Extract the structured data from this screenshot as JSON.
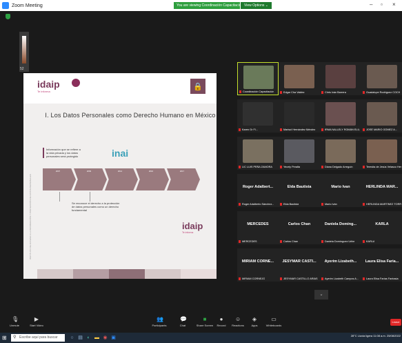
{
  "window": {
    "title": "Zoom Meeting",
    "share_banner": "You are viewing Coordinación Capacitación's screen",
    "view_options": "View Options ⌄",
    "minimize": "–",
    "restore": "▫",
    "close": "×"
  },
  "self_view": {
    "label": "52"
  },
  "slide": {
    "logo_text": "idaip",
    "logo_tag": "Te informa",
    "logo_tag2": "Te informa",
    "lock_icon": "lock-icon",
    "title": "I. Los Datos Personales como Derecho Humano en México",
    "side_text": "INSTITUTO DE ACCESO A LA INFORMACIÓN Y PROTECCIÓN DE DATOS PERSONALES",
    "box_text": "Información que se refiere a la vida privada y los datos personales será protegido",
    "inai_text": "inai",
    "bottom_text": "Se reconoce el derecho a la protección de datos personales como un derecho fundamental",
    "arrows": [
      "2007",
      "2009",
      "2014",
      "2016",
      "2017"
    ],
    "footer_colors": [
      "#d6c9c9",
      "#b59ea3",
      "#8e6f77",
      "#d6c9c9",
      "#e8dcdc"
    ]
  },
  "participants": [
    {
      "name": "Coordinación Capacitación",
      "photo": "#6a7a5a",
      "active": true
    },
    {
      "name": "Edgar Cha Valdez",
      "photo": "#7a6050"
    },
    {
      "name": "Chris Iván Barrera",
      "photo": "#5a4040"
    },
    {
      "name": "Guadalupe Rodríguez COCH",
      "photo": "#6a5a50"
    },
    {
      "name": "Karen Gr Fl...",
      "photo": "#303030"
    },
    {
      "name": "Marisol Hernández Méndez",
      "photo": "#2a2a2a"
    },
    {
      "name": "IRMA NALLELY ROMÁN ELIL...",
      "photo": "#6a5050"
    },
    {
      "name": "JOSÉ MARIO GÓMEZ A...",
      "photo": "#6a5a50"
    },
    {
      "name": "LIC LUIS PEÑA ZAMORA",
      "photo": "#7a7060"
    },
    {
      "name": "Yecely Peralta",
      "photo": "#5a5a60"
    },
    {
      "name": "Diana Delgado Arreguín",
      "photo": "#7a6a5a"
    },
    {
      "name": "Teresita de Jesús Velasco Hern...",
      "photo": "#7a6050"
    },
    {
      "name": "Roger Adalbert...",
      "sub": "Roger Adalberto Sánchez...",
      "name_only": true
    },
    {
      "name": "Elda Bautista",
      "sub": "Elda Bautista",
      "name_only": true
    },
    {
      "name": "Mario Ivan",
      "sub": "Mario Iván",
      "name_only": true
    },
    {
      "name": "HERLINDA MAR...",
      "sub": "HERLINDA MARTÍNEZ TORRES",
      "name_only": true
    },
    {
      "name": "MERCEDES",
      "sub": "MERCEDES",
      "name_only": true
    },
    {
      "name": "Carlos Chan",
      "sub": "Carlos Chan",
      "name_only": true
    },
    {
      "name": "Daniela Doming...",
      "sub": "Daniela Domínguez Uribe",
      "name_only": true
    },
    {
      "name": "KARLA",
      "sub": "KARLA",
      "name_only": true
    },
    {
      "name": "MIRIAM CORNE...",
      "sub": "MIRIAM CORNEJO",
      "name_only": true
    },
    {
      "name": "JESYMAR CASTI...",
      "sub": "JESYMAR CASTILLO ARIAS",
      "name_only": true
    },
    {
      "name": "Ayerim Lizabeth...",
      "sub": "Ayerim Lizabeth Campos A...",
      "name_only": true
    },
    {
      "name": "Laura Elisa Faria...",
      "sub": "Laura Elisa Farías Fantasía",
      "name_only": true
    }
  ],
  "toolbar": {
    "unmute": "Unmute",
    "start_video": "Start Video",
    "participants": "Participants",
    "participants_count": "34",
    "chat": "Chat",
    "share_screen": "Share Screen",
    "record": "Record",
    "reactions": "Reactions",
    "apps": "Apps",
    "whiteboards": "Whiteboards",
    "end": "Leave"
  },
  "taskbar": {
    "search_placeholder": "Escribe aquí para buscar",
    "weather": "28°C Lluvia ligera",
    "time": "11:08 a.m.",
    "date": "25/08/2022"
  }
}
